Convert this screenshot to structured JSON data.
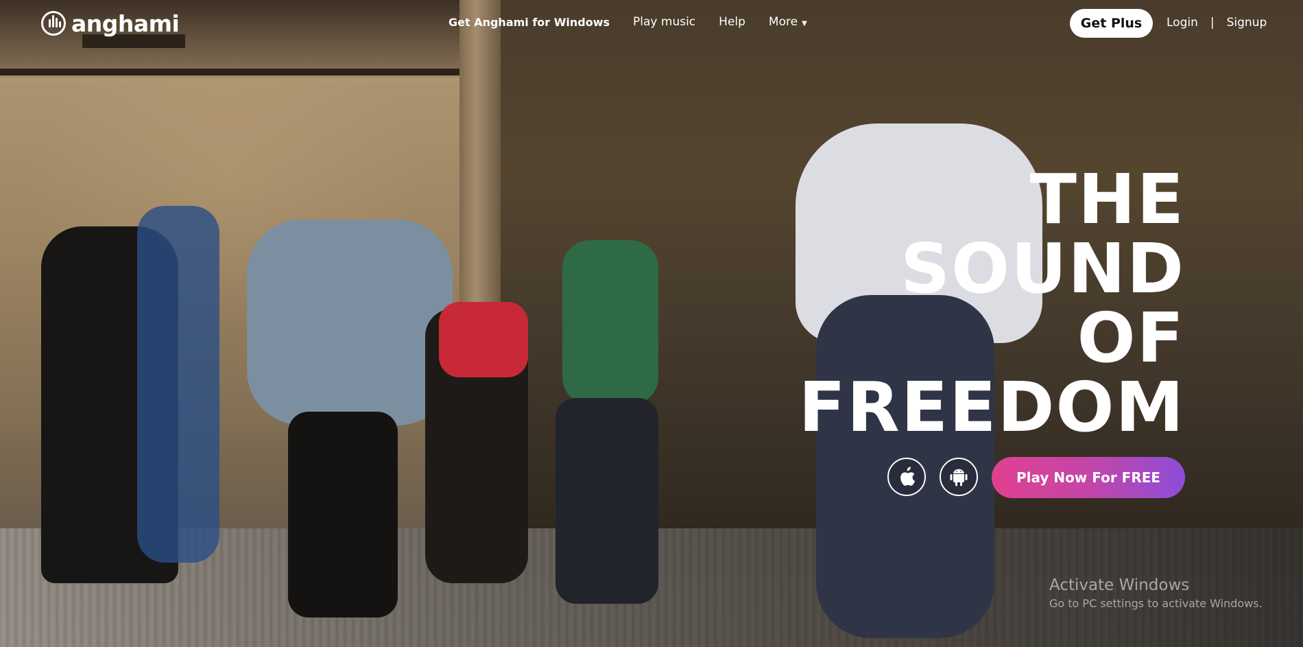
{
  "brand": {
    "logo_text": "anghami"
  },
  "nav": {
    "links": [
      "Get Anghami for Windows",
      "Play music",
      "Help",
      "More"
    ],
    "get_plus_label": "Get Plus",
    "login_label": "Login",
    "separator": "|",
    "signup_label": "Signup"
  },
  "hero": {
    "headline_lines": [
      "THE",
      "SOUND",
      "OF",
      "FREEDOM"
    ],
    "cta_label": "Play Now For FREE",
    "store_icons": [
      "apple-icon",
      "android-icon"
    ]
  },
  "watermark": {
    "title": "Activate Windows",
    "subtitle": "Go to PC settings to activate Windows."
  },
  "colors": {
    "cta_gradient_start": "#e0408f",
    "cta_gradient_end": "#8d4dd8",
    "text": "#ffffff"
  }
}
